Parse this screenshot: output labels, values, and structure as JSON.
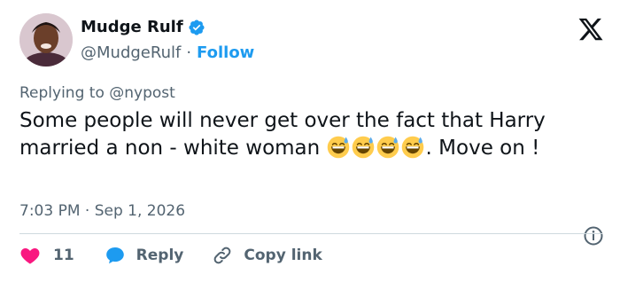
{
  "author": {
    "name": "Mudge Rulf",
    "handle": "@MudgeRulf",
    "separator": "·",
    "follow_label": "Follow"
  },
  "replying_to": "Replying to @nypost",
  "tweet": {
    "text": "Some people will never get over the fact that Harry married a non - white woman",
    "emoji_count": 4,
    "emoji": "grinning-sweat-face",
    "text_after": ". Move on !"
  },
  "timestamp": "7:03 PM · Sep 1, 2026",
  "actions": {
    "like_count": "11",
    "reply_label": "Reply",
    "copy_link_label": "Copy link"
  },
  "colors": {
    "accent": "#1d9bf0",
    "like": "#f91880",
    "muted": "#536471"
  },
  "icons": [
    "verified-badge-icon",
    "x-logo-icon",
    "info-icon",
    "heart-icon",
    "reply-bubble-icon",
    "link-icon"
  ]
}
